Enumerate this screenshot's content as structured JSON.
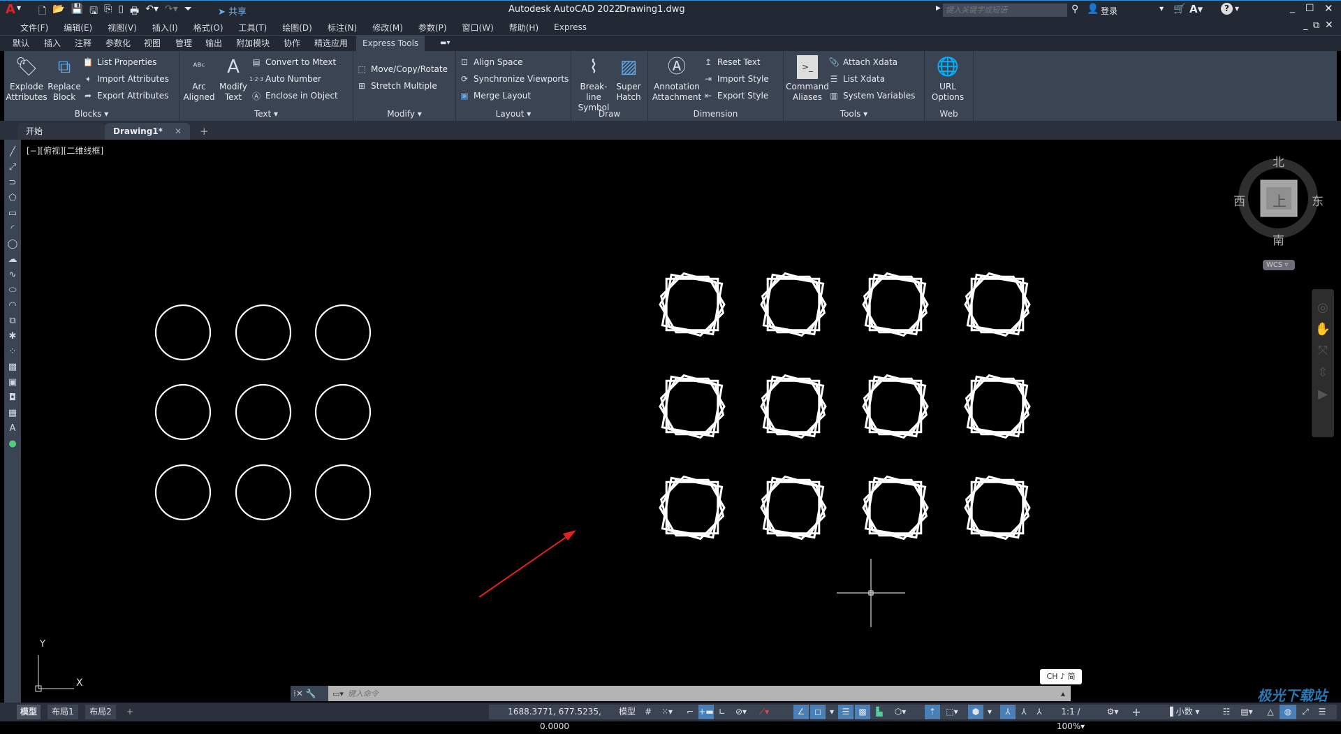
{
  "titlebar": {
    "app_title": "Autodesk AutoCAD 2022",
    "doc_title": "Drawing1.dwg",
    "share_label": "共享",
    "search_placeholder": "键入关键字或短语",
    "signin_label": "登录"
  },
  "menubar": [
    "文件(F)",
    "编辑(E)",
    "视图(V)",
    "插入(I)",
    "格式(O)",
    "工具(T)",
    "绘图(D)",
    "标注(N)",
    "修改(M)",
    "参数(P)",
    "窗口(W)",
    "帮助(H)",
    "Express"
  ],
  "ribbon_tabs": [
    "默认",
    "插入",
    "注释",
    "参数化",
    "视图",
    "管理",
    "输出",
    "附加模块",
    "协作",
    "精选应用",
    "Express Tools"
  ],
  "active_ribbon_tab": "Express Tools",
  "panels": {
    "blocks": {
      "title": "Blocks",
      "explode": "Explode Attributes",
      "replace": "Replace Block",
      "list": "List Properties",
      "import": "Import Attributes",
      "export": "Export Attributes"
    },
    "text": {
      "title": "Text",
      "arc": "Arc Aligned",
      "modify": "Modify Text",
      "convert": "Convert to Mtext",
      "auto": "Auto Number",
      "enclose": "Enclose in Object"
    },
    "modify": {
      "title": "Modify",
      "move": "Move/Copy/Rotate",
      "stretch": "Stretch Multiple"
    },
    "layout": {
      "title": "Layout",
      "align": "Align Space",
      "sync": "Synchronize Viewports",
      "merge": "Merge Layout"
    },
    "draw": {
      "title": "Draw",
      "breakline": "Break-line Symbol",
      "hatch": "Super Hatch"
    },
    "dimension": {
      "title": "Dimension",
      "annotation": "Annotation Attachment",
      "reset": "Reset Text",
      "import": "Import Style",
      "export": "Export Style"
    },
    "tools": {
      "title": "Tools",
      "aliases": "Command Aliases",
      "attach": "Attach Xdata",
      "list": "List Xdata",
      "sysvars": "System Variables"
    },
    "web": {
      "title": "Web",
      "url": "URL Options"
    }
  },
  "doc_tabs": [
    {
      "label": "开始"
    },
    {
      "label": "Drawing1*",
      "active": true
    }
  ],
  "viewport_label": "[−][俯视][二维线框]",
  "viewcube": {
    "north": "北",
    "south": "南",
    "east": "东",
    "west": "西",
    "face": "上",
    "wcs": "WCS"
  },
  "ucs": {
    "x": "X",
    "y": "Y"
  },
  "command": {
    "placeholder": "键入命令"
  },
  "ime": "CH ♪ 简",
  "layout_tabs": [
    "模型",
    "布局1",
    "布局2"
  ],
  "status": {
    "coords": "1688.3771, 677.5235, 0.0000",
    "model": "模型",
    "scale": "1:1 / 100%",
    "units": "小数"
  },
  "drawing": {
    "circles_grid": [
      3,
      3
    ],
    "stars_grid": [
      3,
      4
    ],
    "line_color": "#ffffff",
    "arrow_color": "#e0201e"
  },
  "watermark": "极光下载站"
}
